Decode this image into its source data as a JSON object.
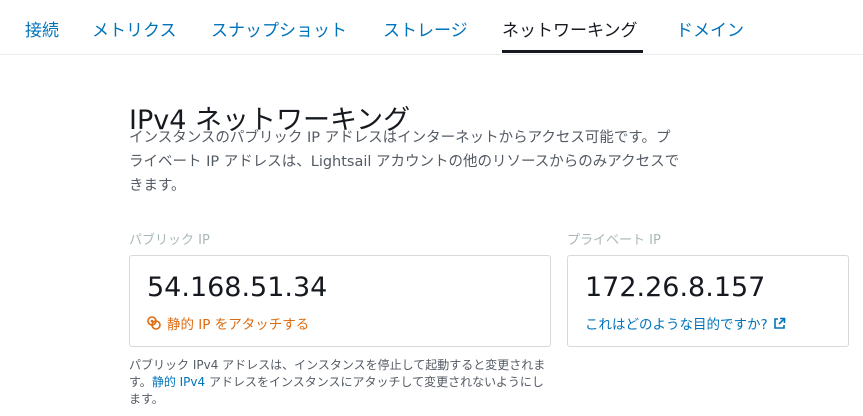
{
  "tabs": [
    {
      "label": "接続"
    },
    {
      "label": "メトリクス"
    },
    {
      "label": "スナップショット"
    },
    {
      "label": "ストレージ"
    },
    {
      "label": "ネットワーキング"
    },
    {
      "label": "ドメイン"
    }
  ],
  "section": {
    "title": "IPv4 ネットワーキング",
    "description_lines": [
      "インスタンスのパブリック IP アドレスはインターネットからアクセス可能です。プ",
      "ライベート IP アドレスは、Lightsail アカウントの他のリソースからのみアクセスで",
      "きます。"
    ]
  },
  "public_ip": {
    "label": "パブリック IP",
    "value": "54.168.51.34",
    "attach_link": "静的 IP をアタッチする",
    "icon": "static-ip-icon"
  },
  "private_ip": {
    "label": "プライベート IP",
    "value": "172.26.8.157",
    "help_link": "これはどのような目的ですか?",
    "icon": "external-link-icon"
  },
  "footnote": {
    "line1": "パブリック IPv4 アドレスは、インスタンスを停止して起動すると変更されま",
    "line2_a": "す。",
    "line2_b": "静的 IPv4",
    "line2_c": " アドレスをインスタンスにアタッチして変更されないようにし",
    "line3": "ます。"
  },
  "colors": {
    "link": "#0073bb",
    "accent": "#dd6b10",
    "text": "#16191f",
    "muted": "#545b64",
    "label": "#aab7b8"
  }
}
